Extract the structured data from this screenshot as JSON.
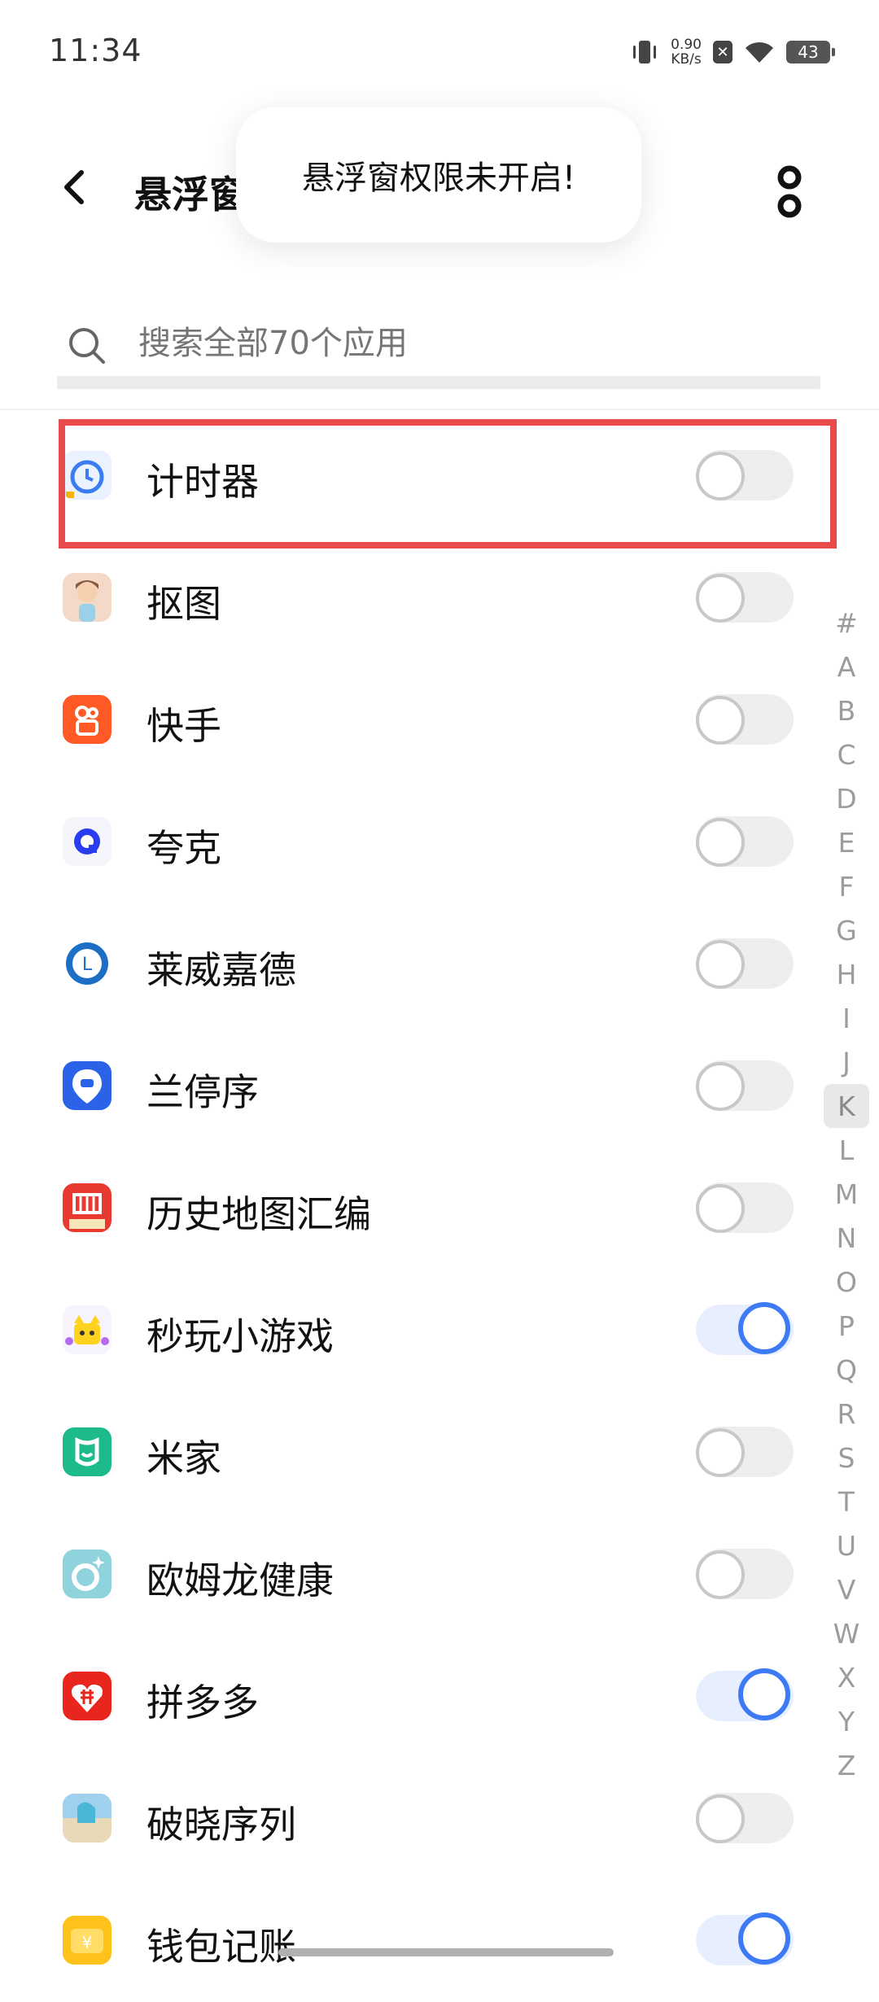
{
  "status_bar": {
    "time": "11:34",
    "speed_value": "0.90",
    "speed_unit": "KB/s",
    "battery": "43"
  },
  "header": {
    "title": "悬浮窗"
  },
  "toast": {
    "message": "悬浮窗权限未开启!"
  },
  "search": {
    "placeholder": "搜索全部70个应用"
  },
  "apps": [
    {
      "name": "计时器",
      "enabled": false
    },
    {
      "name": "抠图",
      "enabled": false
    },
    {
      "name": "快手",
      "enabled": false
    },
    {
      "name": "夸克",
      "enabled": false
    },
    {
      "name": "莱威嘉德",
      "enabled": false
    },
    {
      "name": "兰停序",
      "enabled": false
    },
    {
      "name": "历史地图汇编",
      "enabled": false
    },
    {
      "name": "秒玩小游戏",
      "enabled": true
    },
    {
      "name": "米家",
      "enabled": false
    },
    {
      "name": "欧姆龙健康",
      "enabled": false
    },
    {
      "name": "拼多多",
      "enabled": true
    },
    {
      "name": "破晓序列",
      "enabled": false
    },
    {
      "name": "钱包记账",
      "enabled": true
    }
  ],
  "alphabet_index": [
    "#",
    "A",
    "B",
    "C",
    "D",
    "E",
    "F",
    "G",
    "H",
    "I",
    "J",
    "K",
    "L",
    "M",
    "N",
    "O",
    "P",
    "Q",
    "R",
    "S",
    "T",
    "U",
    "V",
    "W",
    "X",
    "Y",
    "Z"
  ],
  "alphabet_active": "K",
  "colors": {
    "accent": "#3d7af5",
    "highlight": "#e84b4b"
  }
}
